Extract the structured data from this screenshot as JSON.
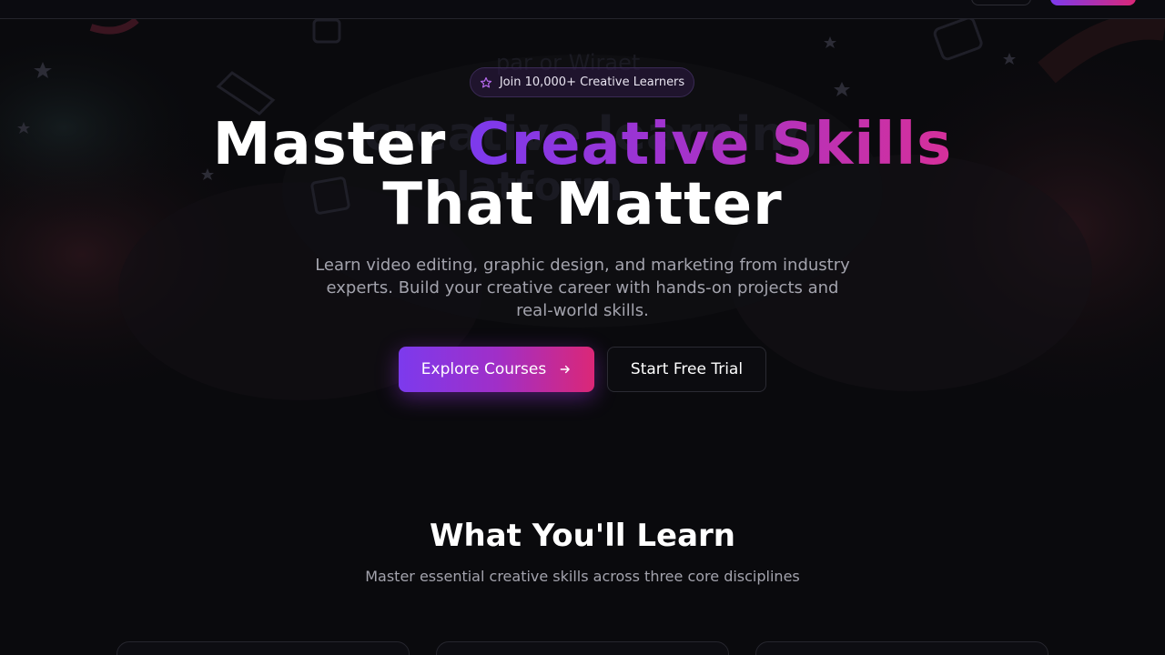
{
  "nav": {
    "login_label": "",
    "signup_label": ""
  },
  "hero": {
    "badge_text": "Join 10,000+ Creative Learners",
    "title_word1": "Master",
    "title_highlight": "Creative Skills",
    "title_line2": "That Matter",
    "subtitle": "Learn video editing, graphic design, and marketing from industry experts. Build your creative career with hands-on projects and real-world skills.",
    "primary_cta": "Explore Courses",
    "secondary_cta": "Start Free Trial"
  },
  "learn_section": {
    "title": "What You'll Learn",
    "subtitle": "Master essential creative skills across three core disciplines"
  },
  "colors": {
    "accent_purple": "#7c3aed",
    "accent_pink": "#db2777",
    "background": "#0a0a0d",
    "muted_text": "#a3a3ad"
  },
  "icons": {
    "badge": "star-icon",
    "primary_cta": "arrow-right-icon"
  }
}
